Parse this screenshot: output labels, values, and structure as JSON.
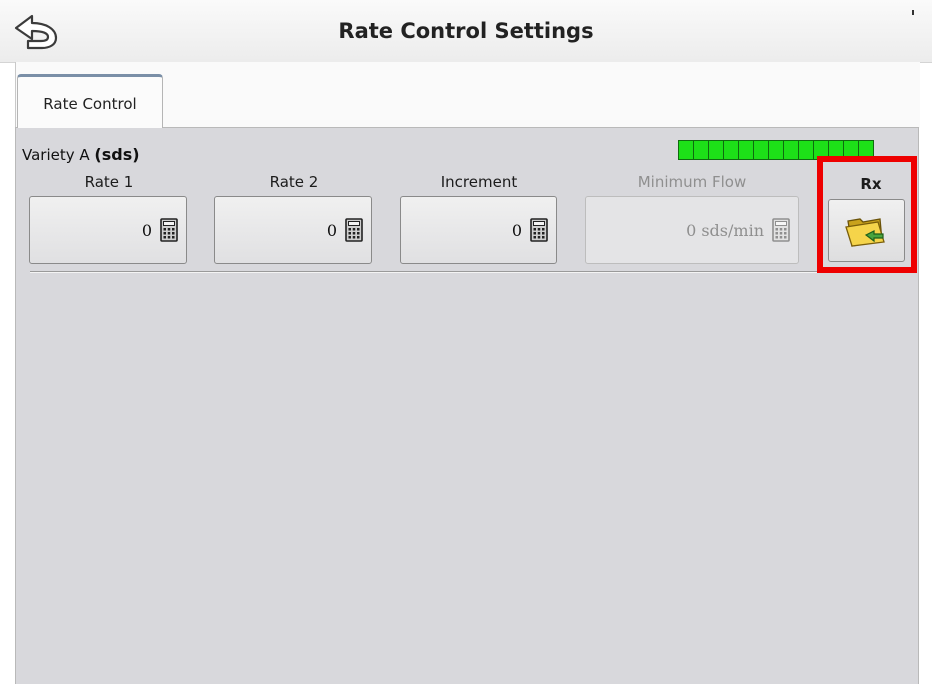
{
  "header": {
    "title": "Rate Control Settings",
    "back_icon": "back-arrow-icon"
  },
  "tabs": [
    {
      "label": "Rate Control",
      "active": true
    }
  ],
  "product": {
    "name": "Variety A",
    "unit": "(sds)"
  },
  "status_meter": {
    "segments": 13,
    "color": "#1de018"
  },
  "fields": {
    "rate1": {
      "label": "Rate 1",
      "value": "0",
      "icon": "calculator-icon"
    },
    "rate2": {
      "label": "Rate 2",
      "value": "0",
      "icon": "calculator-icon"
    },
    "increment": {
      "label": "Increment",
      "value": "0",
      "icon": "calculator-icon"
    },
    "minimum_flow": {
      "label": "Minimum Flow",
      "value": "0 sds/min",
      "icon": "calculator-icon",
      "disabled": true
    }
  },
  "rx": {
    "label": "Rx",
    "icon": "prescription-folder-icon"
  },
  "highlight_color": "#ee0000"
}
